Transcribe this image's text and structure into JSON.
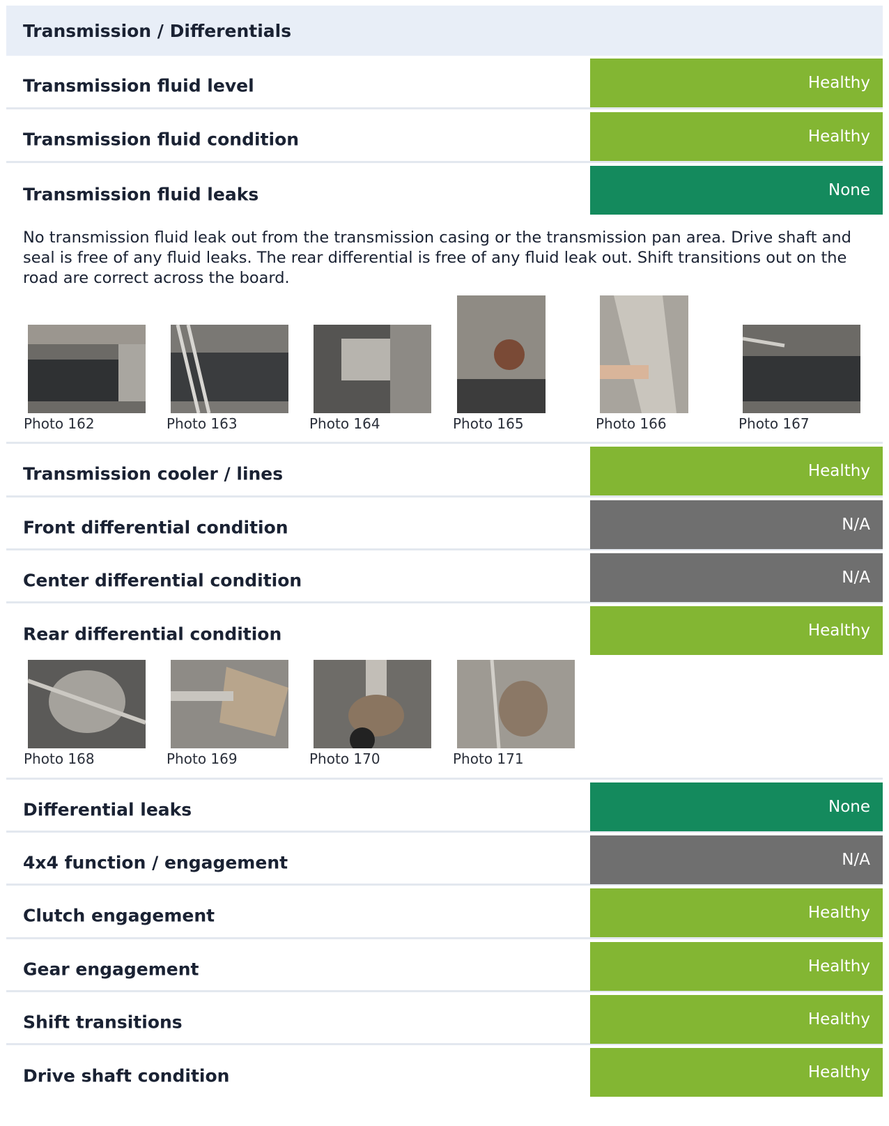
{
  "section": {
    "title": "Transmission / Differentials"
  },
  "colors": {
    "healthy": "#83b633",
    "none": "#148a5d",
    "na": "#6f6f6f",
    "header_bg": "#e8eef7"
  },
  "rows": [
    {
      "label": "Transmission fluid level",
      "status": "Healthy"
    },
    {
      "label": "Transmission fluid condition",
      "status": "Healthy"
    },
    {
      "label": "Transmission fluid leaks",
      "status": "None",
      "note": "No transmission fluid leak out from the transmission casing or the transmission pan area. Drive shaft and seal is free of any fluid leaks. The rear differential is free of any fluid leak out. Shift transitions out on the road are correct across the board.",
      "photos": [
        "Photo 162",
        "Photo 163",
        "Photo 164",
        "Photo 165",
        "Photo 166",
        "Photo 167"
      ]
    },
    {
      "label": "Transmission cooler / lines",
      "status": "Healthy"
    },
    {
      "label": "Front differential condition",
      "status": "N/A"
    },
    {
      "label": "Center differential condition",
      "status": "N/A"
    },
    {
      "label": "Rear differential condition",
      "status": "Healthy",
      "photos": [
        "Photo 168",
        "Photo 169",
        "Photo 170",
        "Photo 171"
      ]
    },
    {
      "label": "Differential leaks",
      "status": "None"
    },
    {
      "label": "4x4 function / engagement",
      "status": "N/A"
    },
    {
      "label": "Clutch engagement",
      "status": "Healthy"
    },
    {
      "label": "Gear engagement",
      "status": "Healthy"
    },
    {
      "label": "Shift transitions",
      "status": "Healthy"
    },
    {
      "label": "Drive shaft condition",
      "status": "Healthy"
    }
  ]
}
